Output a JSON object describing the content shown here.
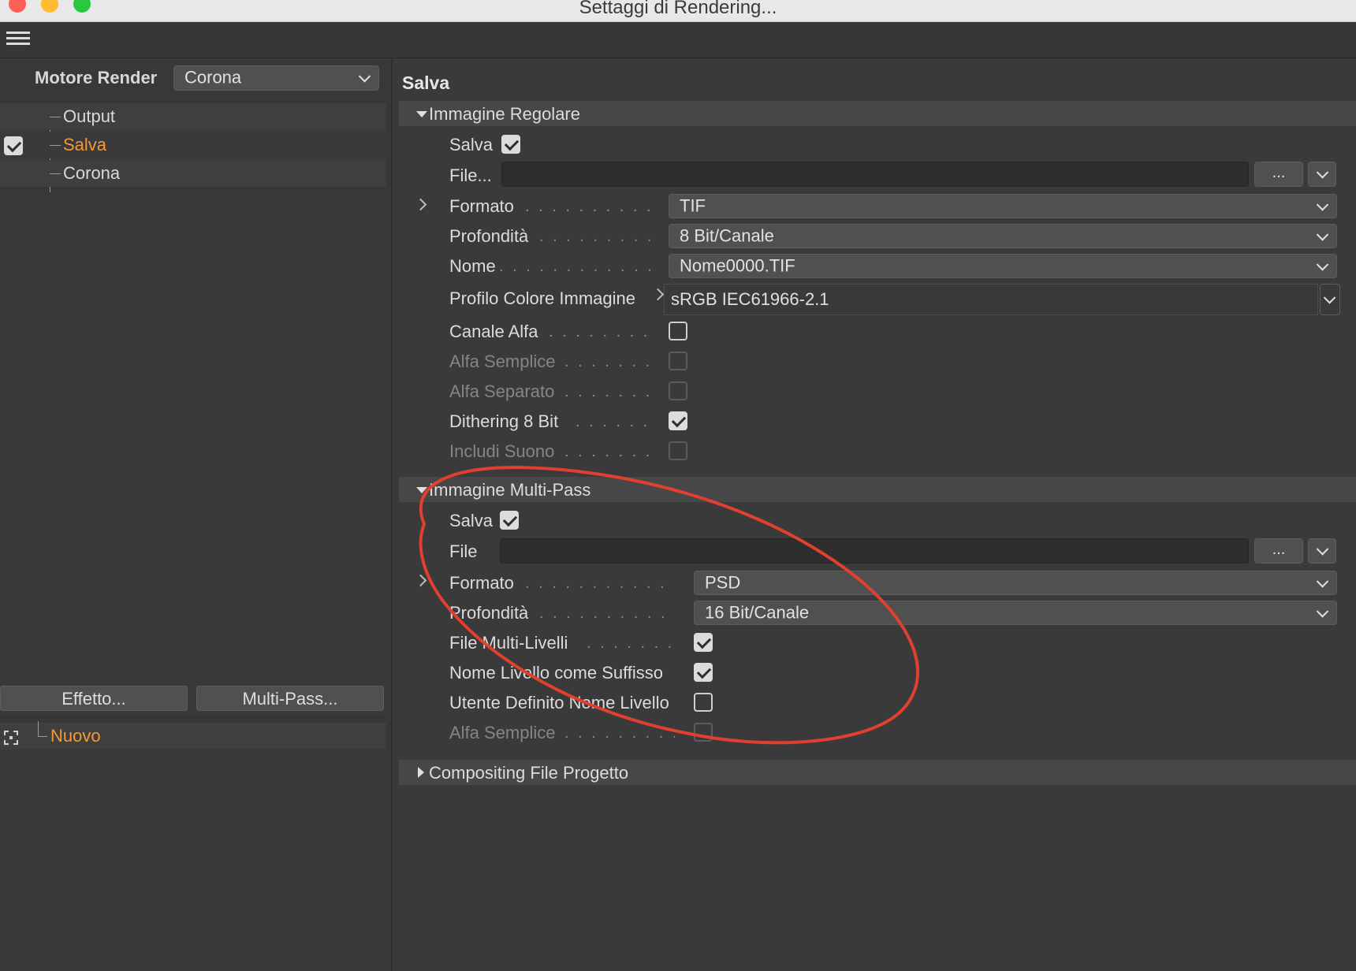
{
  "window": {
    "title": "Settaggi di Rendering..."
  },
  "left_panel": {
    "engine_label": "Motore Render",
    "engine_value": "Corona",
    "tree": [
      {
        "label": "Output"
      },
      {
        "label": "Salva"
      },
      {
        "label": "Corona"
      }
    ],
    "effect_button": "Effetto...",
    "multipass_button": "Multi-Pass...",
    "new_item": "Nuovo"
  },
  "right_panel": {
    "section_title": "Salva",
    "regular": {
      "header": "Immagine Regolare",
      "save_label": "Salva",
      "save_checked": true,
      "file_label": "File...",
      "browse_label": "...",
      "format_label": "Formato",
      "format_value": "TIF",
      "depth_label": "Profondità",
      "depth_value": "8 Bit/Canale",
      "name_label": "Nome",
      "name_value": "Nome0000.TIF",
      "color_profile_label": "Profilo Colore Immagine",
      "color_profile_value": "sRGB IEC61966-2.1",
      "alpha_label": "Canale Alfa",
      "straight_alpha_label": "Alfa Semplice",
      "separate_alpha_label": "Alfa Separato",
      "dithering_label": "Dithering 8 Bit",
      "sound_label": "Includi Suono",
      "alpha_checked": false,
      "straight_alpha_checked": false,
      "separate_alpha_checked": false,
      "dithering_checked": true,
      "sound_checked": false
    },
    "multipass": {
      "header": "Immagine Multi-Pass",
      "save_label": "Salva",
      "save_checked": true,
      "file_label": "File",
      "browse_label": "...",
      "format_label": "Formato",
      "format_value": "PSD",
      "depth_label": "Profondità",
      "depth_value": "16 Bit/Canale",
      "multilayer_label": "File Multi-Livelli",
      "layer_suffix_label": "Nome Livello come Suffisso",
      "user_layer_name_label": "Utente Definito Nome Livello",
      "straight_alpha_label": "Alfa Semplice",
      "multilayer_checked": true,
      "layer_suffix_checked": true,
      "user_layer_name_checked": false,
      "straight_alpha_checked": false
    },
    "compositing": {
      "header": "Compositing File Progetto"
    }
  },
  "colors": {
    "accent_orange": "#f39a36",
    "annotation_red": "#e0402f",
    "panel_bg": "#3a3a3a"
  }
}
